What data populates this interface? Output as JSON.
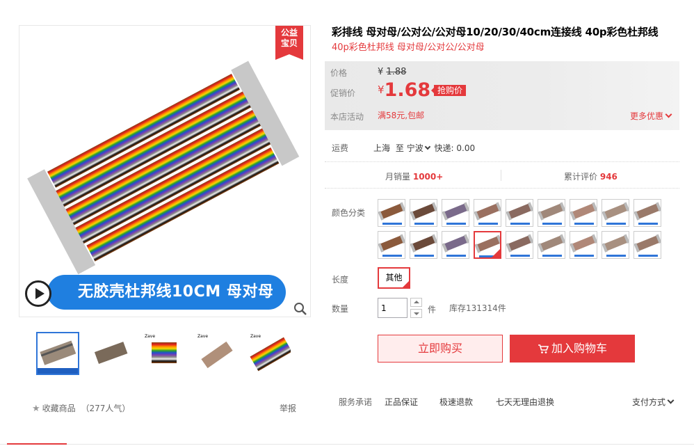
{
  "gallery": {
    "charity_badge": [
      "公益",
      "宝贝"
    ],
    "banner_text": "无胶壳杜邦线10CM 母对母",
    "thumbnails_brand": "Zave",
    "favorite_label": "收藏商品",
    "popularity": "（277人气）",
    "report_label": "举报"
  },
  "product": {
    "title": "彩排线 母对母/公对公/公对母10/20/30/40cm连接线 40p彩色杜邦线",
    "subtitle": "40p彩色杜邦线 母对母/公对公/公对母"
  },
  "price": {
    "price_label": "价格",
    "currency": "¥",
    "original": "1.88",
    "promo_label": "促销价",
    "promo": "1.68",
    "promo_tag": "抢购价",
    "store_activity_label": "本店活动",
    "store_activity": "满58元,包邮",
    "more_discount": "更多优惠"
  },
  "shipping": {
    "label": "运费",
    "from": "上海",
    "to_word": "至",
    "to": "宁波",
    "method": "快递: 0.00"
  },
  "stats": {
    "monthly_sales_label": "月销量",
    "monthly_sales": "1000+",
    "reviews_label": "累计评价",
    "reviews": "946"
  },
  "options": {
    "color_label": "颜色分类",
    "swatch_count": 18,
    "selected_swatch": 12,
    "length_label": "长度",
    "length_value": "其他",
    "qty_label": "数量",
    "qty_value": "1",
    "unit": "件",
    "stock": "库存131314件"
  },
  "actions": {
    "buy_now": "立即购买",
    "add_to_cart": "加入购物车"
  },
  "services": {
    "label": "服务承诺",
    "items": [
      "正品保证",
      "极速退款",
      "七天无理由退换"
    ],
    "payment": "支付方式"
  },
  "colors": {
    "accent": "#e4393c",
    "banner_blue": "#1f7fe0",
    "thumb_active": "#2f75d8"
  }
}
